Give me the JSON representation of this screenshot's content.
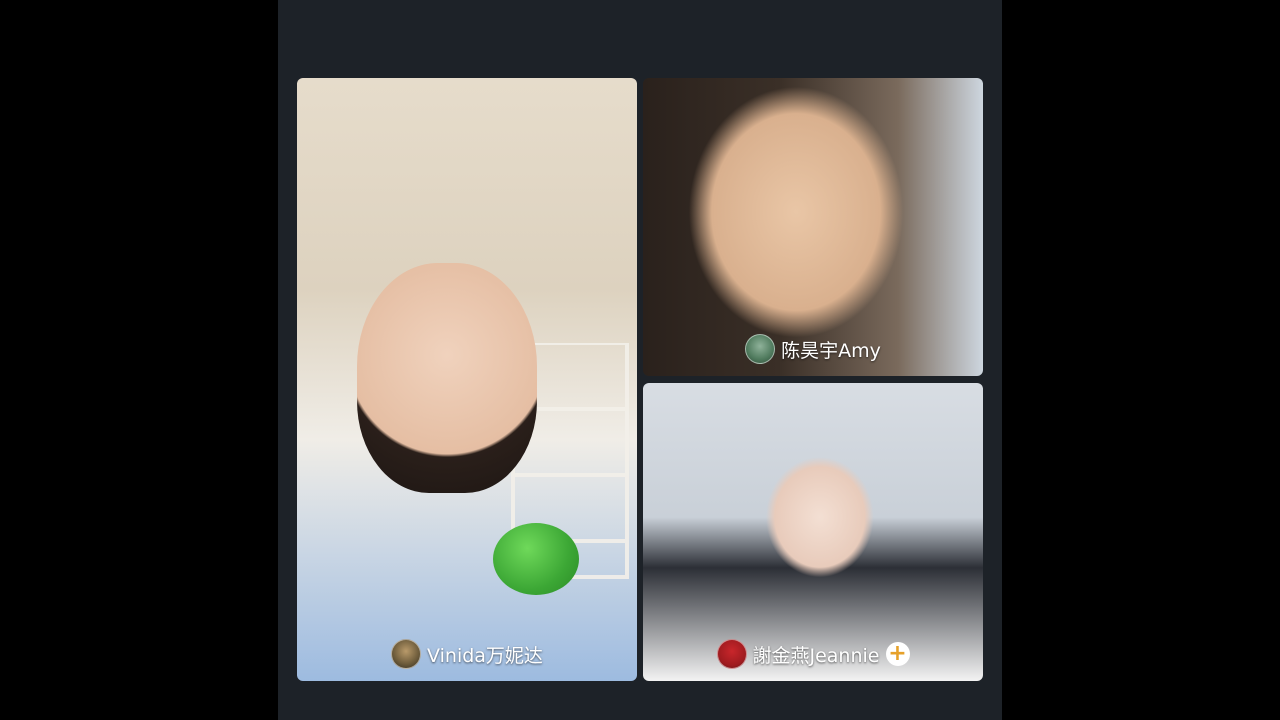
{
  "participants": [
    {
      "name": "Vinida万妮达",
      "avatar_icon": "avatar-icon"
    },
    {
      "name": "陈昊宇Amy",
      "avatar_icon": "avatar-icon"
    },
    {
      "name": "謝金燕Jeannie",
      "avatar_icon": "avatar-icon",
      "follow_icon": "plus-icon",
      "follow_symbol": "+"
    }
  ],
  "colors": {
    "stage_background": "#1d2228",
    "page_background": "#000000",
    "follow_accent": "#e6a12a"
  }
}
